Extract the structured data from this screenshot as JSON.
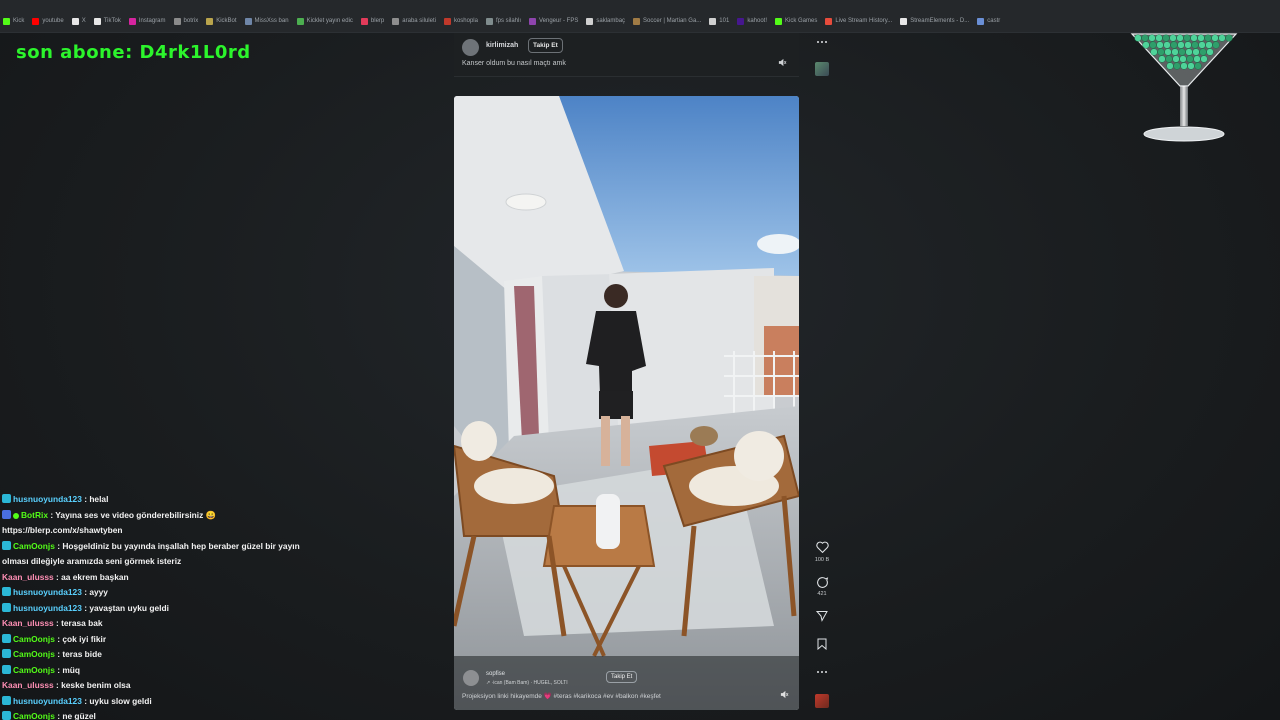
{
  "bookmarks": [
    {
      "label": "Kick",
      "color": "#53fc18"
    },
    {
      "label": "youtube",
      "color": "#ff0000"
    },
    {
      "label": "X",
      "color": "#e7e7e7"
    },
    {
      "label": "TikTok",
      "color": "#e7e7e7"
    },
    {
      "label": "Instagram",
      "color": "#d6249f"
    },
    {
      "label": "botrix",
      "color": "#8b8b8b"
    },
    {
      "label": "KickBot",
      "color": "#b9a44c"
    },
    {
      "label": "MissXss ban",
      "color": "#6f86a8"
    },
    {
      "label": "Kicklet yayın edic",
      "color": "#4caf50"
    },
    {
      "label": "blerp",
      "color": "#e23b5a"
    },
    {
      "label": "araba siluleti",
      "color": "#8e8e8e"
    },
    {
      "label": "koshopla",
      "color": "#c0392b"
    },
    {
      "label": "fps silahlı",
      "color": "#7f8c8d"
    },
    {
      "label": "Vengeur - FPS",
      "color": "#8e44ad"
    },
    {
      "label": "saklambaç",
      "color": "#d0d0d0"
    },
    {
      "label": "Soccer | Martian Ga...",
      "color": "#a07b45"
    },
    {
      "label": "101",
      "color": "#d0d0d0"
    },
    {
      "label": "kahoot!",
      "color": "#46178f"
    },
    {
      "label": "Kick Games",
      "color": "#53fc18"
    },
    {
      "label": "Live Stream History...",
      "color": "#e74c3c"
    },
    {
      "label": "StreamElements - D...",
      "color": "#e7e7e7"
    },
    {
      "label": "castr",
      "color": "#6a8fd6"
    }
  ],
  "overlay": {
    "last_sub": "son abone: D4rk1L0rd"
  },
  "post_top": {
    "username": "kirlimizah",
    "follow_label": "Takip Et",
    "caption": "Kanser oldum bu nasıl maçtı amk"
  },
  "video": {
    "username": "sopfise",
    "music": "↗ ·ican (Bam Bam) · HUGEL, SOLTI",
    "follow_label": "Takip Et",
    "caption": "Projeksiyon linki hikayemde 💗 #teras #karikoca #ev #balkon #keşfet"
  },
  "actions": {
    "likes": "100 B",
    "comments": "421"
  },
  "chat": [
    {
      "badge": "#2bb7d6",
      "user": "husnuoyunda123",
      "color": "#5ad1ff",
      "text": " : helal"
    },
    {
      "badge": "#4a6ee0",
      "user": "BotRix",
      "color": "#53fc18",
      "text": " : Yayına ses ve video gönderebilirsiniz 😀",
      "bot": true
    },
    {
      "badge": "",
      "user": "",
      "color": "#f2f2f2",
      "text": "https://blerp.com/x/shawtyben"
    },
    {
      "badge": "#2bb7d6",
      "user": "CamOonjs",
      "color": "#53fc18",
      "text": " : Hoşgeldiniz bu yayında inşallah hep beraber güzel bir yayın"
    },
    {
      "badge": "",
      "user": "",
      "color": "#f2f2f2",
      "text": "olması dileğiyle aramızda seni görmek isteriz"
    },
    {
      "badge": "",
      "user": "Kaan_ulusss",
      "color": "#ff8fb5",
      "text": " : aa ekrem başkan"
    },
    {
      "badge": "#2bb7d6",
      "user": "husnuoyunda123",
      "color": "#5ad1ff",
      "text": " : ayyy"
    },
    {
      "badge": "#2bb7d6",
      "user": "husnuoyunda123",
      "color": "#5ad1ff",
      "text": " : yavaştan uyku geldi"
    },
    {
      "badge": "",
      "user": "Kaan_ulusss",
      "color": "#ff8fb5",
      "text": " : terasa bak"
    },
    {
      "badge": "#2bb7d6",
      "user": "CamOonjs",
      "color": "#53fc18",
      "text": " : çok iyi fikir"
    },
    {
      "badge": "#2bb7d6",
      "user": "CamOonjs",
      "color": "#53fc18",
      "text": " : teras bide"
    },
    {
      "badge": "#2bb7d6",
      "user": "CamOonjs",
      "color": "#53fc18",
      "text": " : müq"
    },
    {
      "badge": "",
      "user": "Kaan_ulusss",
      "color": "#ff8fb5",
      "text": " : keske benim olsa"
    },
    {
      "badge": "#2bb7d6",
      "user": "husnuoyunda123",
      "color": "#5ad1ff",
      "text": " : uyku slow geldi"
    },
    {
      "badge": "#2bb7d6",
      "user": "CamOonjs",
      "color": "#53fc18",
      "text": " : ne güzel"
    }
  ]
}
